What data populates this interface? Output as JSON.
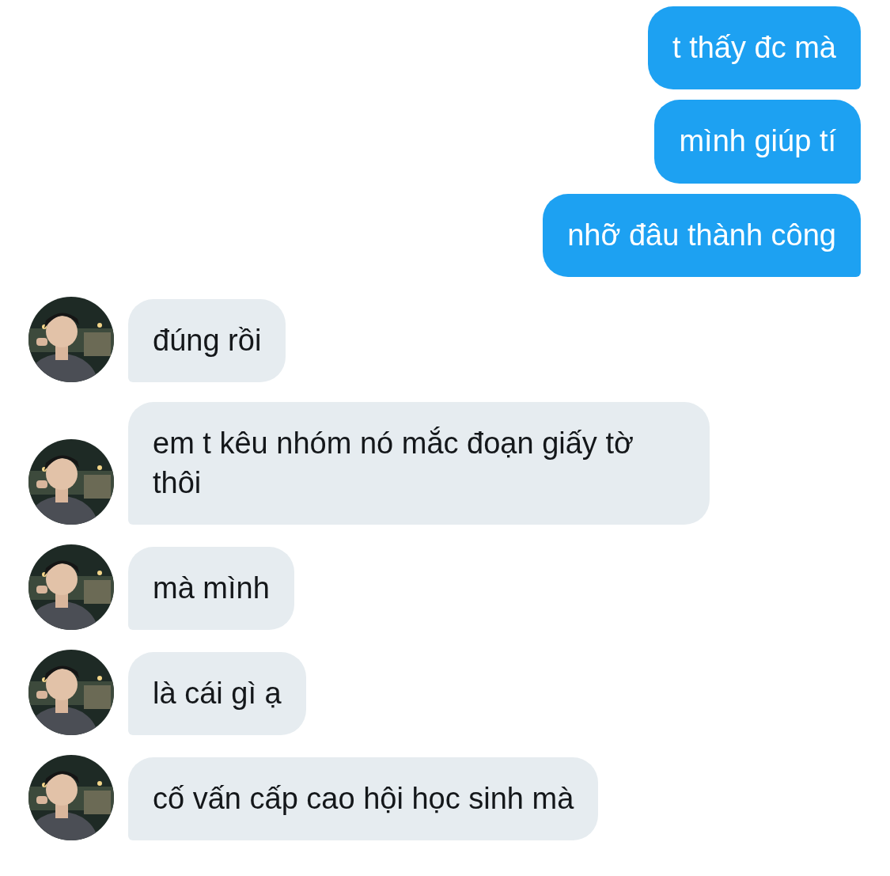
{
  "messages": [
    {
      "kind": "outgoing",
      "text": "t thấy đc mà"
    },
    {
      "kind": "outgoing",
      "text": "mình giúp tí"
    },
    {
      "kind": "outgoing",
      "text": "nhỡ đâu thành công"
    },
    {
      "kind": "incoming",
      "text": "đúng rồi"
    },
    {
      "kind": "incoming",
      "text": "em t kêu nhóm nó mắc đoạn giấy tờ thôi"
    },
    {
      "kind": "incoming",
      "text": "mà mình"
    },
    {
      "kind": "incoming",
      "text": "là cái gì ạ"
    },
    {
      "kind": "incoming",
      "text": "cố vấn cấp cao hội học sinh mà"
    }
  ]
}
